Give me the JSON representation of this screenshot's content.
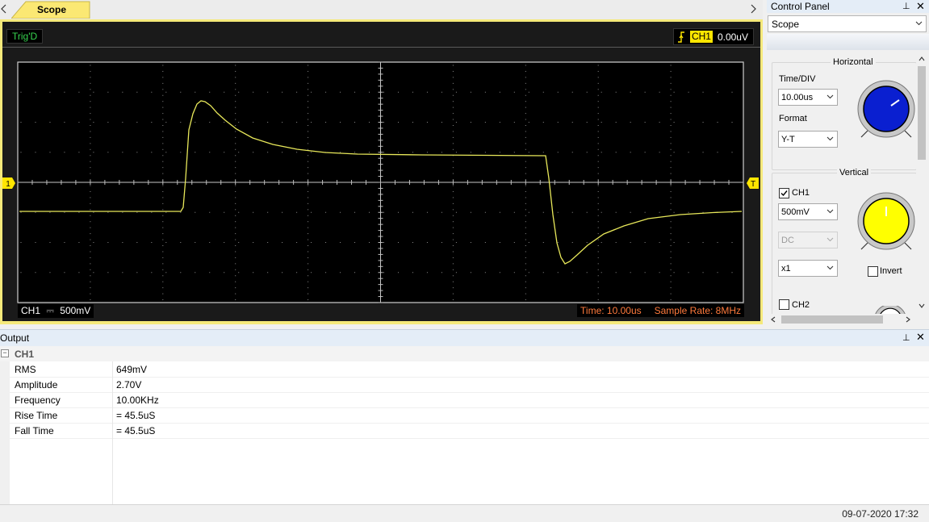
{
  "tabs": {
    "active_label": "Scope"
  },
  "scope": {
    "trig_status": "Trig'D",
    "trigger_channel": "CH1",
    "trigger_level": "0.00uV",
    "ch1_scale_channel": "CH1",
    "ch1_scale_coupling_symbol": "⎓",
    "ch1_scale_value": "500mV",
    "time_info": "Time: 10.00us",
    "sample_rate": "Sample Rate: 8MHz",
    "ch1_marker": "1",
    "trigger_marker": "T",
    "colors": {
      "trace": "#e8e85a",
      "background": "#000000",
      "grid": "#8a8a8a",
      "frame": "#f5e97a"
    }
  },
  "output": {
    "title": "Output",
    "group_label": "CH1",
    "rows": [
      {
        "name": "RMS",
        "value": "649mV"
      },
      {
        "name": "Amplitude",
        "value": "2.70V"
      },
      {
        "name": "Frequency",
        "value": "10.00KHz"
      },
      {
        "name": "Rise Time",
        "value": "= 45.5uS"
      },
      {
        "name": "Fall Time",
        "value": "= 45.5uS"
      }
    ]
  },
  "status": {
    "datetime": "09-07-2020  17:32"
  },
  "control_panel": {
    "title": "Control Panel",
    "selected": "Scope",
    "horizontal": {
      "legend": "Horizontal",
      "time_div_label": "Time/DIV",
      "time_div_value": "10.00us",
      "format_label": "Format",
      "format_value": "Y-T",
      "knob_color": "#0a1fd0"
    },
    "vertical": {
      "legend": "Vertical",
      "ch1_label": "CH1",
      "ch1_checked": true,
      "ch1_volt_div": "500mV",
      "coupling": "DC",
      "probe": "x1",
      "invert_label": "Invert",
      "ch2_label": "CH2",
      "knob_color": "#ffff00"
    }
  }
}
